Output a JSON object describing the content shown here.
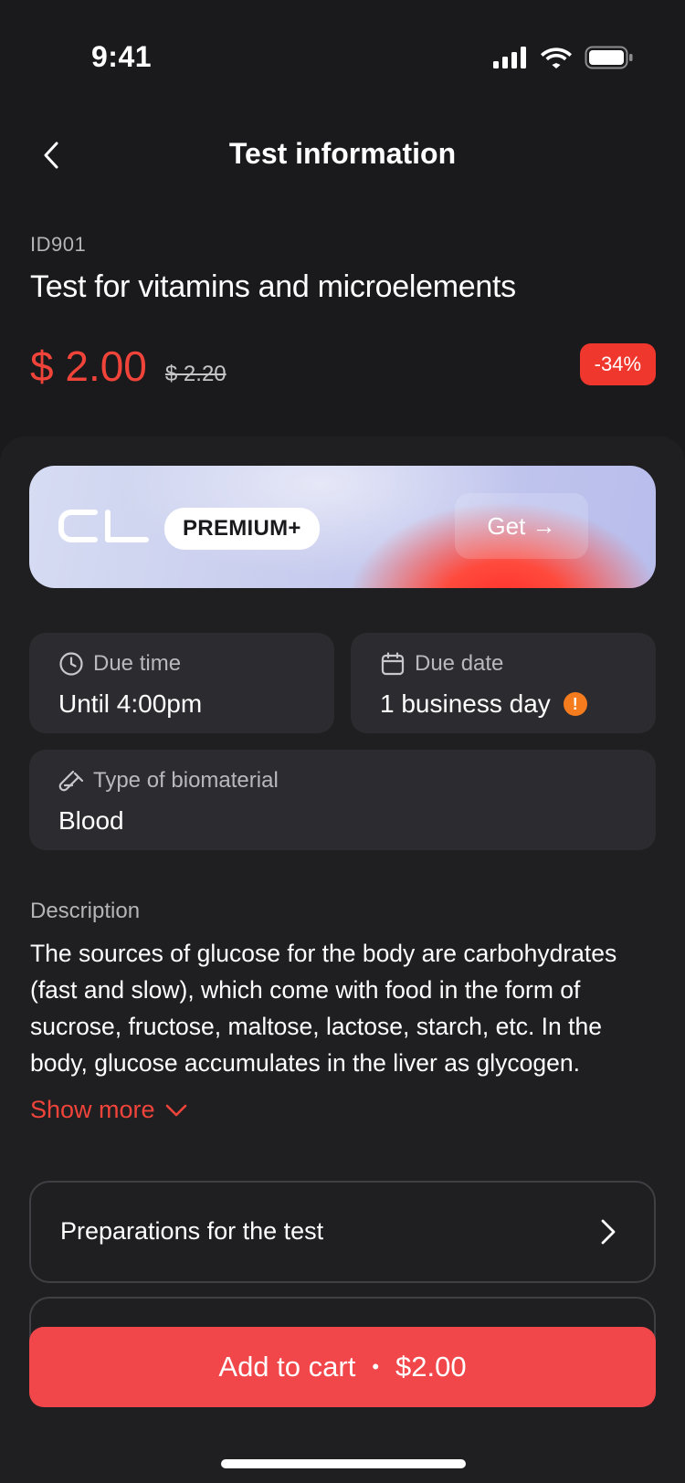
{
  "status_bar": {
    "time": "9:41"
  },
  "header": {
    "title": "Test information"
  },
  "test": {
    "id": "ID901",
    "name": "Test for vitamins and microelements",
    "price": "$ 2.00",
    "old_price": "$ 2.20",
    "discount": "-34%"
  },
  "premium": {
    "logo_text": "CL",
    "badge": "PREMIUM+",
    "cta": "Get →"
  },
  "info": {
    "due_time_label": "Due time",
    "due_time_value": "Until 4:00pm",
    "due_date_label": "Due date",
    "due_date_value": "1 business day",
    "warning_glyph": "!",
    "biomaterial_label": "Type of biomaterial",
    "biomaterial_value": "Blood"
  },
  "description": {
    "label": "Description",
    "text": "The sources of glucose for the body are carbohydrates (fast and slow), which come with food in the form of sucrose, fructose, maltose, lactose, starch, etc. In the body, glucose accumulates in the liver as glycogen.",
    "show_more": "Show more"
  },
  "sections": [
    {
      "label": "Preparations for the test"
    }
  ],
  "cart": {
    "label": "Add to cart",
    "separator": "•",
    "price": "$2.00"
  },
  "colors": {
    "background": "#1a1a1c",
    "accent": "#f0443a",
    "cart_button": "#f1474a",
    "card": "#2c2c30",
    "warning": "#f47b1e"
  }
}
